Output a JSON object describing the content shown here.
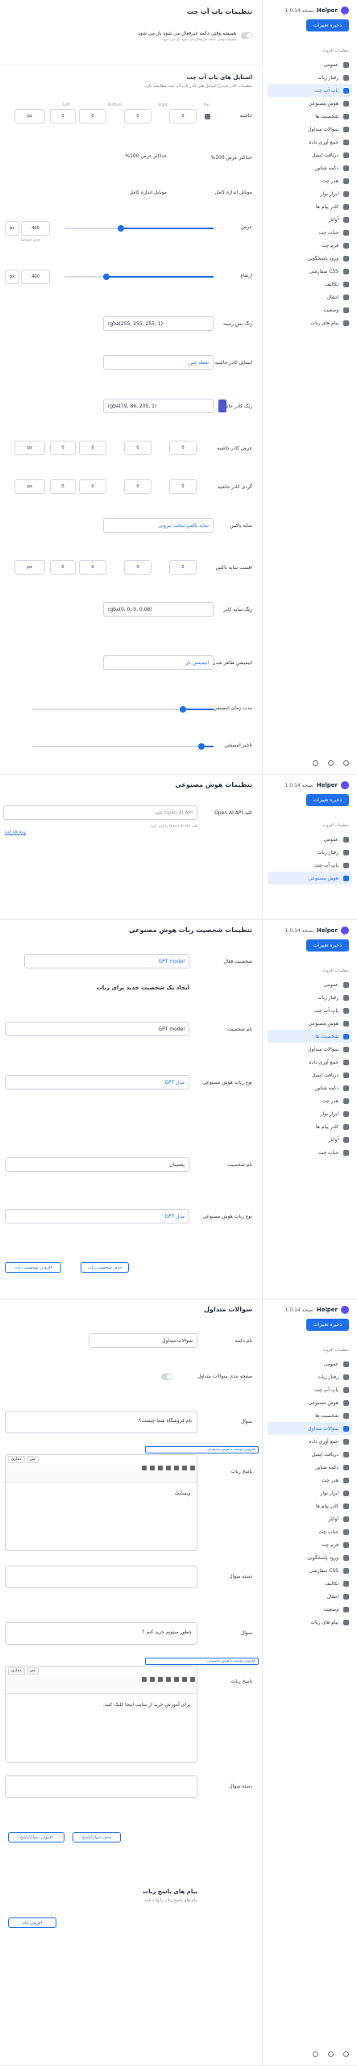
{
  "app": {
    "name": "Helper",
    "version_label": "نسخه 1.0.14",
    "save_label": "ذخیره تغییرات",
    "plugin_settings": "تنظیمات افزونه"
  },
  "nav": [
    {
      "label": "عمومی",
      "icon": "gear-icon"
    },
    {
      "label": "رفتار ربات",
      "icon": "robot-icon"
    },
    {
      "label": "پاپ آپ چت",
      "icon": "chat-popup-icon"
    },
    {
      "label": "هوش مصنوعی",
      "icon": "ai-icon"
    },
    {
      "label": "شخصیت ها",
      "icon": "person-icon"
    },
    {
      "label": "سوالات متداول",
      "icon": "question-icon"
    },
    {
      "label": "جمع آوری داده",
      "icon": "database-icon"
    },
    {
      "label": "دریافت ایمیل",
      "icon": "mail-icon"
    },
    {
      "label": "دکمه شناور",
      "icon": "button-icon"
    },
    {
      "label": "هدر چت",
      "icon": "header-icon"
    },
    {
      "label": "ابزار نوار",
      "icon": "toolbar-icon"
    },
    {
      "label": "کادر پیام ها",
      "icon": "message-box-icon"
    },
    {
      "label": "آواتار",
      "icon": "avatar-icon"
    },
    {
      "label": "حباب چت",
      "icon": "bubble-icon"
    },
    {
      "label": "فرم چت",
      "icon": "form-icon"
    },
    {
      "label": "ورود پاسخگویی",
      "icon": "login-icon"
    },
    {
      "label": "CSS سفارشی",
      "icon": "code-icon"
    },
    {
      "label": "تکالیف",
      "icon": "task-icon"
    },
    {
      "label": "انتقال",
      "icon": "transfer-icon"
    },
    {
      "label": "وضعیت",
      "icon": "status-icon"
    },
    {
      "label": "پیام های ربات",
      "icon": "robot-message-icon"
    }
  ],
  "s1": {
    "title": "تنظیمات پاپ آپ چت",
    "always_open_label": "همیشه وقتی دکمه غیرفعال می شود باز می شود",
    "always_open_hint": "همیشه وقتی دکمه غیرفعال می شود باز می شود",
    "style_title": "استایل های پاپ آپ چت",
    "style_sub": "تنظیمات کادر چت را استایل های کادر پاپ آپ چت مطابقت دارد.",
    "padding_label": "حاشیه",
    "side_labels": [
      "Top",
      "Right",
      "Bottom",
      "Left"
    ],
    "values": [
      "0",
      "0",
      "0",
      "0"
    ],
    "unit": "px",
    "max_width_label": "حداکثر عرض 100%",
    "max_width_check": "حداکثر عرض 100%",
    "full_size_label": "موبایل اندازه کامل",
    "full_size_check": "موبایل اندازه کامل",
    "width_label": "عرض",
    "width_value": "400",
    "width_unit": "px",
    "width_hint": "Select unit",
    "height_label": "ارتفاع",
    "height_value": "400",
    "bg_label": "رنگ پس زمینه",
    "bg_value": "rgba(255, 255, 255, 1)",
    "border_style_label": "استایل کادر حاشیه",
    "border_style_value": "نقطه چین",
    "border_color_label": "رنگ کادر حاشیه",
    "border_color_value": "rgba(79, 86, 205, 1)",
    "border_width_label": "عرض کادر حاشیه",
    "radius_label": "گردی کادر حاشیه",
    "shadow_label": "سایه باکس",
    "shadow_value": "سایه باکس سخت بیرونی",
    "shadow_offset_label": "افست سایه باکس",
    "shadow_color_label": "رنگ سایه کادر",
    "shadow_color_value": "rgba(0, 0, 0, 0.08)",
    "anim_label": "انیمیشن ظاهر شدن چت ربات",
    "anim_value": "انیمیشن باز",
    "anim_duration_label": "مدت زمان انیمیشن",
    "delay_label": "تاخیر انیمیشن"
  },
  "s2": {
    "title": "تنظیمات هوش مصنوعی",
    "api_label": "کلید Open AI API",
    "api_placeholder": "Open AI API کلید",
    "api_hint": "کلید Open AI API را وارد کنید.",
    "api_link": "Get API Key"
  },
  "s3": {
    "title": "تنظیمات شخصیت ربات هوش مصنوعی",
    "active_label": "شخصیت فعال",
    "active_value": "GPT model",
    "create_title": "ایجاد یک شخصیت جدید برای ربات",
    "name_label": "نام شخصیت",
    "name_value": "GPT model",
    "model_label": "نوع ربات هوش مصنوعی",
    "model_value": "مدل GPT",
    "name2_label": "نام شخصیت",
    "name2_value": "پشتیبان",
    "model2_label": "نوع ربات هوش مصنوعی",
    "model2_value": "مدل GPT",
    "delete_btn": "حذف شخصیت ربات",
    "add_btn": "افزودن شخصیت ربات"
  },
  "s4": {
    "title": "سوالات متداول",
    "btn_name_label": "نام دکمه",
    "btn_name_value": "سوالات متداول",
    "page_toggle_label": "صفحه بندی سوالات متداول",
    "q_label": "سوال",
    "q1": "نام فروشگاه شما چیست؟",
    "a_label": "پاسخ ربات",
    "ai_btn": "افزودن نوشته با هوش مصنوعی",
    "tab_visual": "دیداری",
    "tab_code": "متن",
    "a1": "وبسایت",
    "cat_label": "دسته سوال",
    "q2": "چطور میتونم خرید کنم ؟",
    "a2": "برای آموزش خرید از سایت اینجا کلیک کنید.",
    "add_btn": "افزودن سوال/پاسخ",
    "del_btn": "حذف سوال/پاسخ",
    "msgs_title": "پیام های پاسخ ربات",
    "msgs_sub": "پیام های پاسخ ربات را وارد کنید",
    "add_msg": "افزودن پیام"
  }
}
